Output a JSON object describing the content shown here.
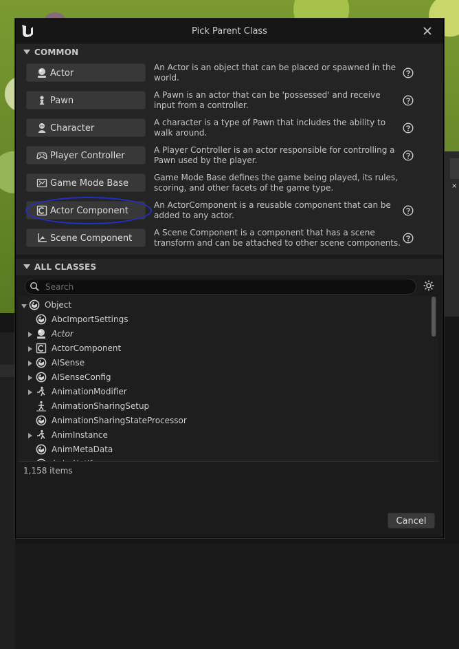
{
  "dialog": {
    "title": "Pick Parent Class",
    "cancel_label": "Cancel"
  },
  "common": {
    "header": "COMMON",
    "items": [
      {
        "label": "Actor",
        "icon": "actor-icon",
        "description": "An Actor is an object that can be placed or spawned in the world.",
        "has_help": true
      },
      {
        "label": "Pawn",
        "icon": "pawn-icon",
        "description": "A Pawn is an actor that can be 'possessed' and receive input from a controller.",
        "has_help": true
      },
      {
        "label": "Character",
        "icon": "character-icon",
        "description": "A character is a type of Pawn that includes the ability to walk around.",
        "has_help": true
      },
      {
        "label": "Player Controller",
        "icon": "gamepad-icon",
        "description": "A Player Controller is an actor responsible for controlling a Pawn used by the player.",
        "has_help": true
      },
      {
        "label": "Game Mode Base",
        "icon": "game-mode-icon",
        "description": "Game Mode Base defines the game being played, its rules, scoring, and other facets of the game type.",
        "has_help": false
      },
      {
        "label": "Actor Component",
        "icon": "actor-component-icon",
        "description": "An ActorComponent is a reusable component that can be added to any actor.",
        "has_help": true
      },
      {
        "label": "Scene Component",
        "icon": "scene-component-icon",
        "description": "A Scene Component is a component that has a scene transform and can be attached to other scene components.",
        "has_help": true
      }
    ]
  },
  "all_classes": {
    "header": "ALL CLASSES",
    "search_placeholder": "Search",
    "items_count": "1,158 items",
    "tree": [
      {
        "label": "Object",
        "icon": "object-icon",
        "expander": "down",
        "italic": false
      },
      {
        "label": "AbcImportSettings",
        "icon": "object-icon",
        "expander": "none",
        "italic": false
      },
      {
        "label": "Actor",
        "icon": "actor-icon",
        "expander": "right",
        "italic": true
      },
      {
        "label": "ActorComponent",
        "icon": "actor-component-icon",
        "expander": "right",
        "italic": false
      },
      {
        "label": "AISense",
        "icon": "object-icon",
        "expander": "right",
        "italic": false
      },
      {
        "label": "AISenseConfig",
        "icon": "object-icon",
        "expander": "right",
        "italic": false
      },
      {
        "label": "AnimationModifier",
        "icon": "animation-icon",
        "expander": "right",
        "italic": false
      },
      {
        "label": "AnimationSharingSetup",
        "icon": "animation-sharing-icon",
        "expander": "none",
        "italic": false
      },
      {
        "label": "AnimationSharingStateProcessor",
        "icon": "object-icon",
        "expander": "none",
        "italic": false
      },
      {
        "label": "AnimInstance",
        "icon": "animation-icon",
        "expander": "right",
        "italic": false
      },
      {
        "label": "AnimMetaData",
        "icon": "object-icon",
        "expander": "none",
        "italic": false
      },
      {
        "label": "AnimNotify",
        "icon": "object-icon",
        "expander": "none",
        "italic": false
      }
    ]
  },
  "colors": {
    "dialog_bg": "#1b1b1b",
    "button_bg": "#383838",
    "highlight_ring": "#2030c8"
  }
}
